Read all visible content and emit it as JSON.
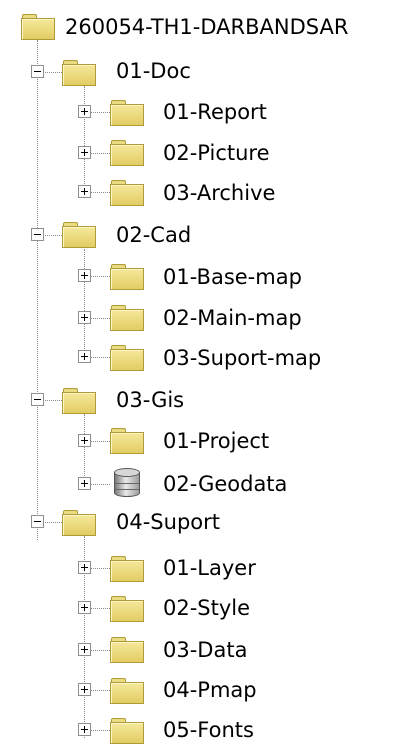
{
  "tree": {
    "root": {
      "label": "260054-TH1-DARBANDSAR",
      "icon": "folder-icon"
    },
    "groups": [
      {
        "label": "01-Doc",
        "icon": "folder-icon",
        "expander": "minus",
        "children": [
          {
            "label": "01-Report",
            "icon": "folder-icon",
            "expander": "plus"
          },
          {
            "label": "02-Picture",
            "icon": "folder-icon",
            "expander": "plus"
          },
          {
            "label": "03-Archive",
            "icon": "folder-icon",
            "expander": "plus"
          }
        ]
      },
      {
        "label": "02-Cad",
        "icon": "folder-icon",
        "expander": "minus",
        "children": [
          {
            "label": "01-Base-map",
            "icon": "folder-icon",
            "expander": "plus"
          },
          {
            "label": "02-Main-map",
            "icon": "folder-icon",
            "expander": "plus"
          },
          {
            "label": "03-Suport-map",
            "icon": "folder-icon",
            "expander": "plus"
          }
        ]
      },
      {
        "label": "03-Gis",
        "icon": "folder-icon",
        "expander": "minus",
        "children": [
          {
            "label": "01-Project",
            "icon": "folder-icon",
            "expander": "plus"
          },
          {
            "label": "02-Geodata",
            "icon": "database-icon",
            "expander": "plus"
          }
        ]
      },
      {
        "label": "04-Suport",
        "icon": "folder-icon",
        "expander": "minus",
        "children": [
          {
            "label": "01-Layer",
            "icon": "folder-icon",
            "expander": "plus"
          },
          {
            "label": "02-Style",
            "icon": "folder-icon",
            "expander": "plus"
          },
          {
            "label": "03-Data",
            "icon": "folder-icon",
            "expander": "plus"
          },
          {
            "label": "04-Pmap",
            "icon": "folder-icon",
            "expander": "plus"
          },
          {
            "label": "05-Fonts",
            "icon": "folder-icon",
            "expander": "plus"
          }
        ]
      }
    ]
  }
}
